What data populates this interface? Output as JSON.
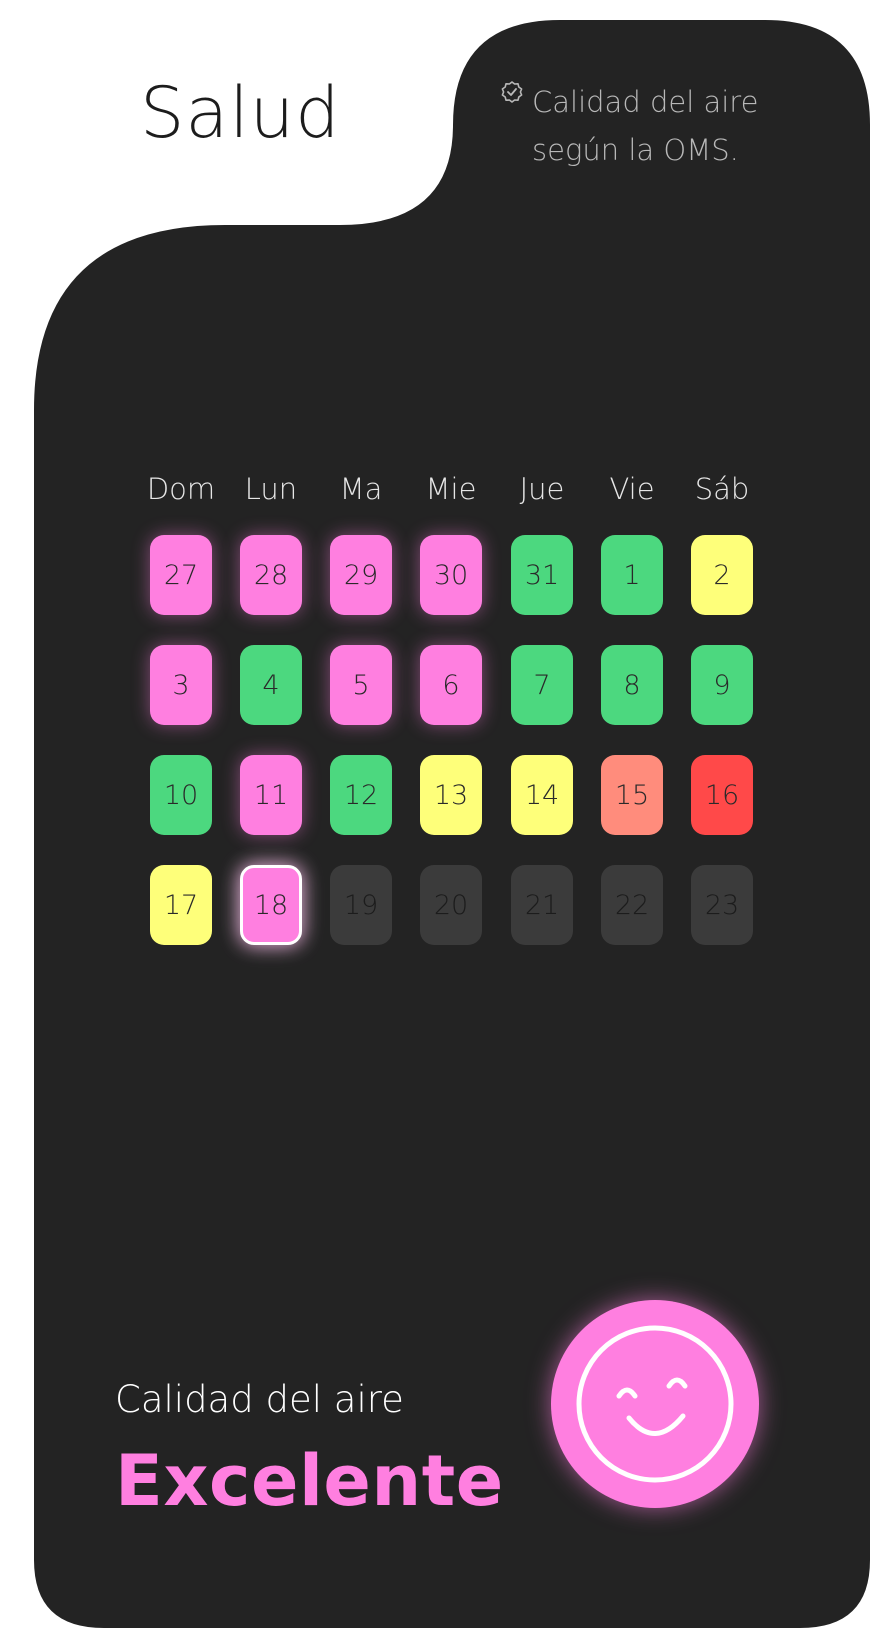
{
  "header": {
    "title": "Salud",
    "note_line_1": "Calidad del aire",
    "note_line_2": "según la OMS.",
    "note_icon": "verified-badge-icon"
  },
  "calendar": {
    "weekdays": [
      "Dom",
      "Lun",
      "Ma",
      "Mie",
      "Jue",
      "Vie",
      "Sáb"
    ],
    "weeks": [
      [
        {
          "day": "27",
          "status": "pink"
        },
        {
          "day": "28",
          "status": "pink"
        },
        {
          "day": "29",
          "status": "pink"
        },
        {
          "day": "30",
          "status": "pink"
        },
        {
          "day": "31",
          "status": "green"
        },
        {
          "day": "1",
          "status": "green"
        },
        {
          "day": "2",
          "status": "yellow"
        }
      ],
      [
        {
          "day": "3",
          "status": "pink"
        },
        {
          "day": "4",
          "status": "green"
        },
        {
          "day": "5",
          "status": "pink"
        },
        {
          "day": "6",
          "status": "pink"
        },
        {
          "day": "7",
          "status": "green"
        },
        {
          "day": "8",
          "status": "green"
        },
        {
          "day": "9",
          "status": "green"
        }
      ],
      [
        {
          "day": "10",
          "status": "green"
        },
        {
          "day": "11",
          "status": "pink"
        },
        {
          "day": "12",
          "status": "green"
        },
        {
          "day": "13",
          "status": "yellow"
        },
        {
          "day": "14",
          "status": "yellow"
        },
        {
          "day": "15",
          "status": "salmon"
        },
        {
          "day": "16",
          "status": "red"
        }
      ],
      [
        {
          "day": "17",
          "status": "yellow"
        },
        {
          "day": "18",
          "status": "pink",
          "selected": true
        },
        {
          "day": "19",
          "status": "future"
        },
        {
          "day": "20",
          "status": "future"
        },
        {
          "day": "21",
          "status": "future"
        },
        {
          "day": "22",
          "status": "future"
        },
        {
          "day": "23",
          "status": "future"
        }
      ]
    ]
  },
  "summary": {
    "label": "Calidad del aire",
    "value": "Excelente",
    "icon": "smiley-face-icon"
  },
  "colors": {
    "card": "#232323",
    "pink": "#ff7fe0",
    "green": "#4cd87f",
    "yellow": "#feff7a",
    "salmon": "#ff8c7c",
    "red": "#ff4949",
    "future": "#3b3b3b"
  }
}
